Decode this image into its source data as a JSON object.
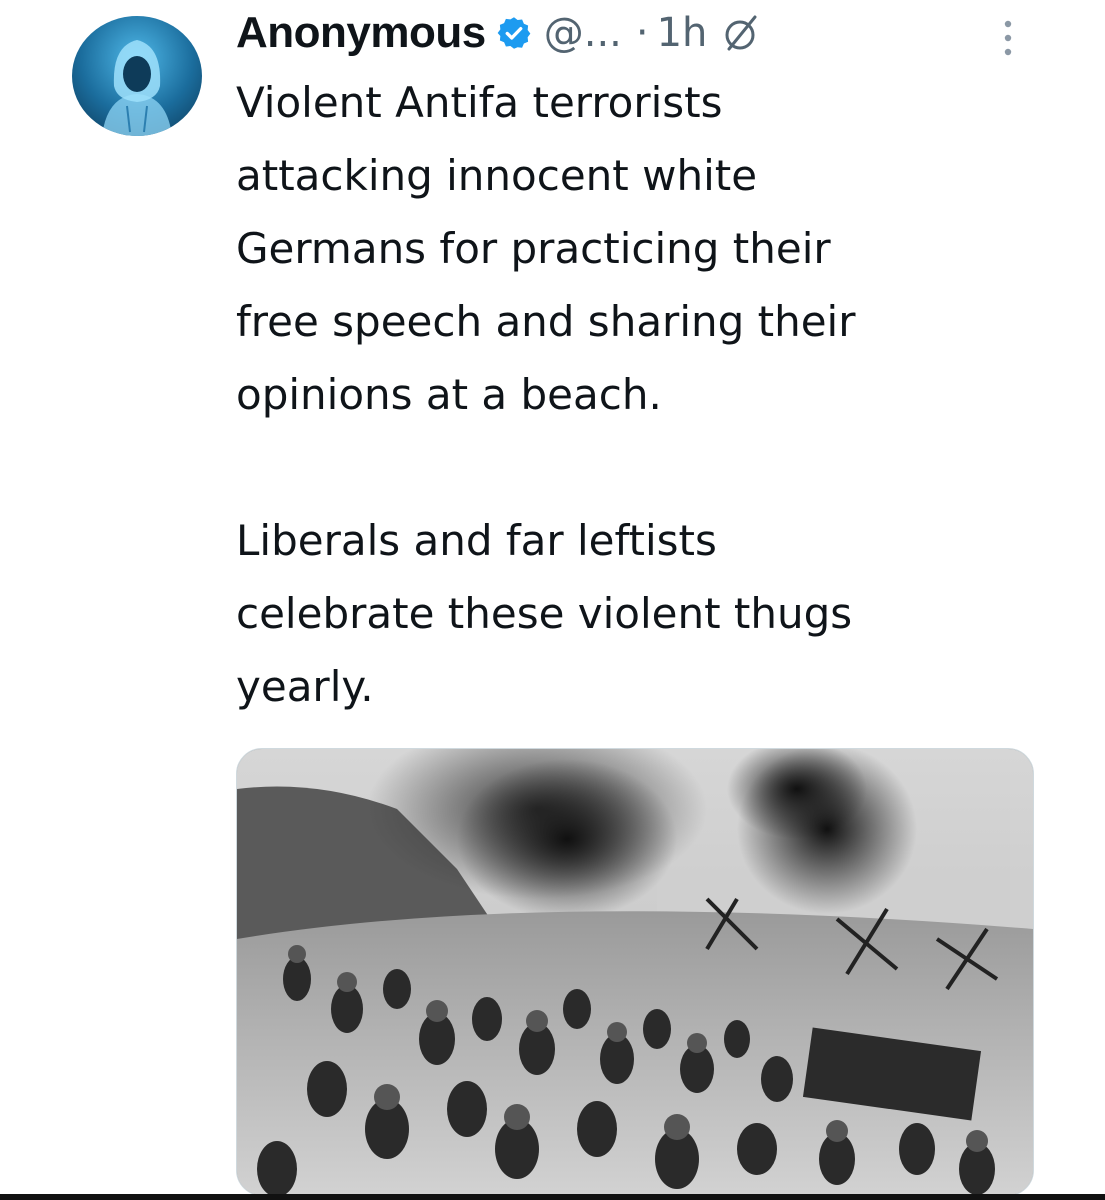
{
  "tweet": {
    "author_name": "Anonymous",
    "handle": "@...",
    "separator": "·",
    "time": "1h",
    "text": "Violent Antifa terrorists\nattacking innocent white\nGermans for practicing their\nfree speech and sharing their\nopinions at a beach.\n\nLiberals and far leftists\ncelebrate these violent thugs\nyearly.",
    "icons": {
      "avatar": "hooded-figure-avatar",
      "verified": "verified-badge-icon",
      "grok": "slash-circle-icon",
      "more": "more-vertical-icon"
    },
    "media": {
      "description_kind": "black-and-white war photograph of soldiers on a beach with smoke"
    }
  },
  "colors": {
    "text": "#0f1419",
    "muted": "#536471",
    "verified": "#1d9bf0"
  }
}
